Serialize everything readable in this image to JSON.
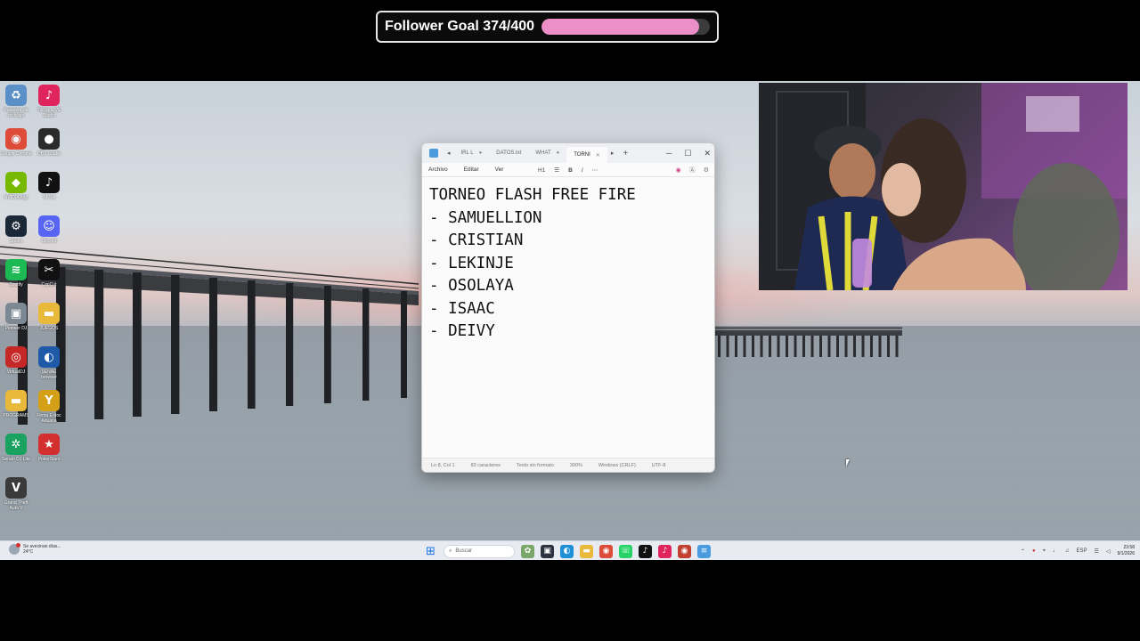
{
  "overlay": {
    "goal_label": "Follower Goal 374/400",
    "goal_current": 374,
    "goal_target": 400,
    "bar_color": "#ec8fc8"
  },
  "desktop_icons": [
    {
      "name": "recycle-bin-icon",
      "label": "Papelera de reciclaje",
      "glyph": "♻",
      "color": "#5a8fc7"
    },
    {
      "name": "tiktok-live-studio-icon",
      "label": "TikTok LIVE Studio",
      "glyph": "♪",
      "color": "#e0245e"
    },
    {
      "name": "chrome-icon",
      "label": "Google Chrome",
      "glyph": "◉",
      "color": "#dd4b39"
    },
    {
      "name": "obs-studio-icon",
      "label": "OBS Studio",
      "glyph": "●",
      "color": "#2b2b2b"
    },
    {
      "name": "nvidia-app-icon",
      "label": "NVIDIA App",
      "glyph": "◆",
      "color": "#76b900"
    },
    {
      "name": "tiktok-icon",
      "label": "TikTok",
      "glyph": "♪",
      "color": "#111111"
    },
    {
      "name": "steam-icon",
      "label": "Steam",
      "glyph": "⚙",
      "color": "#1b2838"
    },
    {
      "name": "discord-icon",
      "label": "Discord",
      "glyph": "☺",
      "color": "#5865f2"
    },
    {
      "name": "spotify-icon",
      "label": "Spotify",
      "glyph": "≋",
      "color": "#1db954"
    },
    {
      "name": "capcut-icon",
      "label": "CapCut",
      "glyph": "✂",
      "color": "#111111"
    },
    {
      "name": "pioneer-dj-icon",
      "label": "Pioneer DJ",
      "glyph": "▣",
      "color": "#7c8894"
    },
    {
      "name": "juegos-folder-icon",
      "label": "JUEGOS",
      "glyph": "▬",
      "color": "#e8b93a"
    },
    {
      "name": "virtual-dj-icon",
      "label": "VirtualDJ",
      "glyph": "◎",
      "color": "#c62828"
    },
    {
      "name": "sena-browser-icon",
      "label": "SENAE browser",
      "glyph": "◐",
      "color": "#1e5aa8"
    },
    {
      "name": "programs-folder-icon",
      "label": "PROGRAMS",
      "glyph": "▬",
      "color": "#e8b93a"
    },
    {
      "name": "firma-edoc-icon",
      "label": "Firma E-doc Aduana",
      "glyph": "Y",
      "color": "#d4a017"
    },
    {
      "name": "serato-dj-icon",
      "label": "Serato DJ Lite",
      "glyph": "✲",
      "color": "#1aa260"
    },
    {
      "name": "pokerstars-icon",
      "label": "PokerStars",
      "glyph": "★",
      "color": "#d32f2f"
    },
    {
      "name": "gta-v-icon",
      "label": "Grand Theft Auto V",
      "glyph": "V",
      "color": "#3a3a3a"
    }
  ],
  "notepad": {
    "tabs": [
      "IRL L",
      "DATOS.txt",
      "WHAT",
      "TORNI"
    ],
    "active_tab_index": 3,
    "menu": [
      "Archivo",
      "Editar",
      "Ver"
    ],
    "heading_tool": "H1",
    "bold_tool": "B",
    "italic_tool": "I",
    "lines": [
      "TORNEO FLASH FREE FIRE",
      "- SAMUELLION",
      "- CRISTIAN",
      "- LEKINJE",
      "- OSOLAYA",
      "- ISAAC",
      "- DEIVY"
    ],
    "status": {
      "position": "Ln 8, Col 1",
      "characters": "83 caracteres",
      "format": "Texto sin formato",
      "zoom": "300%",
      "line_ending": "Windows (CRLF)",
      "encoding": "UTF-8"
    }
  },
  "taskbar": {
    "weather_text": "Se avecinan días...",
    "weather_temp": "24°C",
    "search_placeholder": "Buscar",
    "language": "ESP",
    "time": "23:58",
    "date": "9/1/2026"
  }
}
